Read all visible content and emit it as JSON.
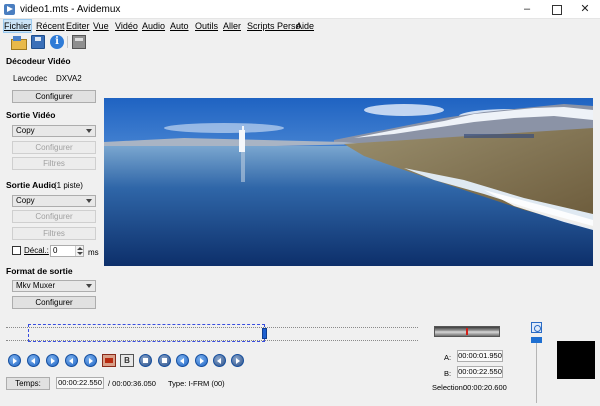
{
  "window": {
    "title": "video1.mts - Avidemux",
    "minimize": "–",
    "close": "✕"
  },
  "menu": {
    "items": [
      {
        "label": "Fichier",
        "active": true
      },
      {
        "label": "Récent"
      },
      {
        "label": "Editer"
      },
      {
        "label": "Vue"
      },
      {
        "label": "Vidéo"
      },
      {
        "label": "Audio"
      },
      {
        "label": "Auto"
      },
      {
        "label": "Outils"
      },
      {
        "label": "Aller"
      },
      {
        "label": "Scripts Perso"
      },
      {
        "label": "Aide"
      }
    ]
  },
  "toolbar": {
    "info_glyph": "i",
    "icons": [
      "open-folder-icon",
      "save-disk-icon",
      "info-icon",
      "calculator-icon"
    ]
  },
  "video_decoder": {
    "heading": "Décodeur Vidéo",
    "codec_label": "Lavcodec",
    "codec_value": "DXVA2",
    "configure": "Configurer"
  },
  "video_output": {
    "heading": "Sortie Vidéo",
    "codec": "Copy",
    "configure": "Configurer",
    "filters": "Filtres"
  },
  "audio_output": {
    "heading": "Sortie Audio",
    "tracks": "(1 piste)",
    "codec": "Copy",
    "configure": "Configurer",
    "filters": "Filtres",
    "shift_label": "Décal.:",
    "shift_value": "0",
    "shift_unit": "ms"
  },
  "output_format": {
    "heading": "Format de sortie",
    "muxer": "Mkv Muxer",
    "configure": "Configurer"
  },
  "timeline": {
    "selection_start_fraction": 0.0,
    "selection_end_fraction": 0.62,
    "cursor_fraction": 0.62
  },
  "navigation": {
    "mark_b_label": "B",
    "buttons": [
      "play",
      "rewind",
      "forward",
      "prev-black",
      "next-black",
      "set-marker-a",
      "set-marker-b",
      "prev-intra",
      "next-intra",
      "prev-cut",
      "next-cut",
      "goto-a",
      "goto-b",
      "goto-frame"
    ]
  },
  "status": {
    "time_button": "Temps:",
    "current_time": "00:00:22.550",
    "total_time": "/ 00:00:36.050",
    "type": "Type:  I-FRM (00)"
  },
  "markers": {
    "a_label": "A:",
    "a_value": "00:00:01.950",
    "b_label": "B:",
    "b_value": "00:00:22.550",
    "selection_label": "Selection:",
    "selection_value": "00:00:20.600"
  },
  "volume_meter": {
    "level": 0.5
  },
  "colors": {
    "accent": "#1e6fd1",
    "selection_dash": "#3a4ee0",
    "meter_needle": "#d3211b"
  }
}
